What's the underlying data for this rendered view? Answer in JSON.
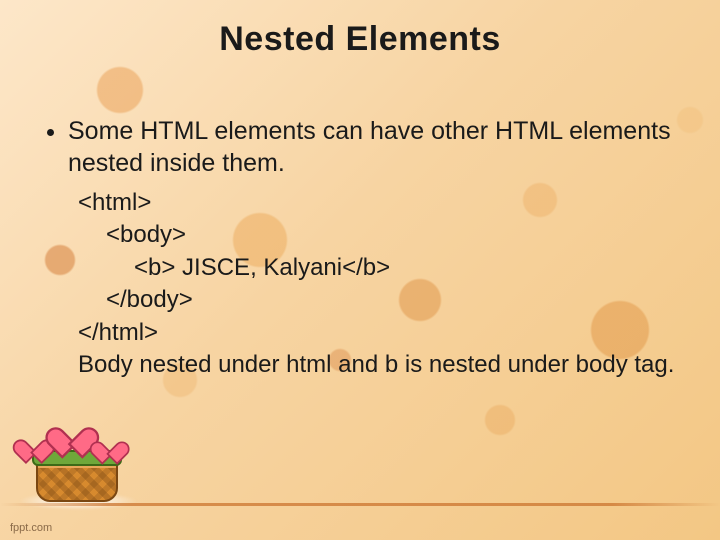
{
  "title": "Nested Elements",
  "bullet": "Some HTML elements can have other HTML elements nested inside them.",
  "code": {
    "l1": "<html>",
    "l2": "<body>",
    "l3": "<b> JISCE, Kalyani</b>",
    "l4": "</body>",
    "l5": "</html>",
    "note": "Body nested under html and b is nested under body tag."
  },
  "credit": "fppt.com"
}
